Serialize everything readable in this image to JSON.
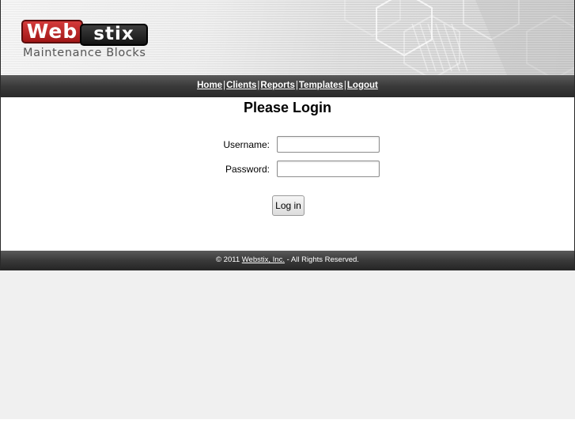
{
  "header": {
    "logo": {
      "part1": "Web",
      "part2": "stix",
      "tagline": "Maintenance Blocks"
    }
  },
  "nav": {
    "items": [
      {
        "label": "Home"
      },
      {
        "label": "Clients"
      },
      {
        "label": "Reports"
      },
      {
        "label": "Templates"
      },
      {
        "label": "Logout"
      }
    ],
    "separator": "|"
  },
  "login": {
    "title": "Please Login",
    "username_label": "Username:",
    "username_value": "",
    "password_label": "Password:",
    "password_value": "",
    "submit_label": "Log in"
  },
  "footer": {
    "copyright": "© 2011",
    "company_link": "Webstix, Inc.",
    "rights": "- All Rights Reserved."
  },
  "colors": {
    "logo_red": "#b31e1e",
    "logo_dark": "#1a1a1a",
    "bar_dark": "#3a3a3a",
    "page_bg_gray": "#f0f0f0"
  }
}
